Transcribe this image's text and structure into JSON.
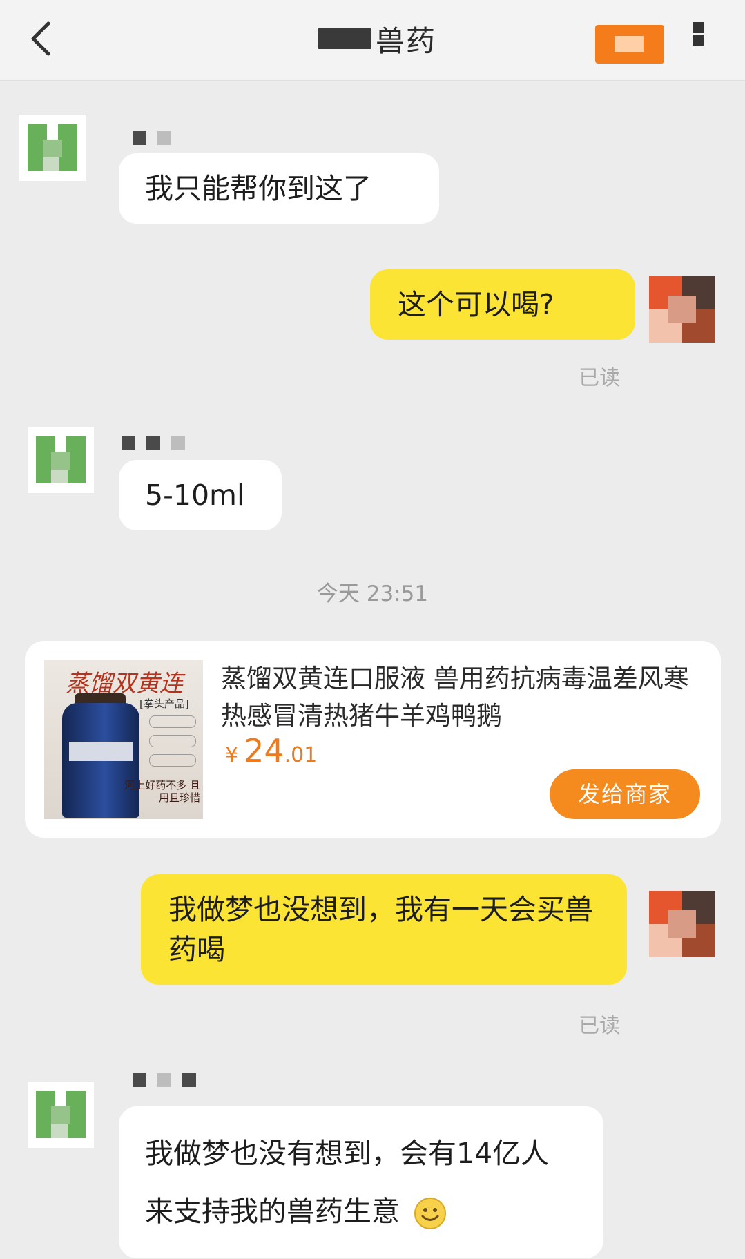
{
  "header": {
    "title": "兽药",
    "back_icon": "chevron-left-icon",
    "shop_icon": "store-icon",
    "more_icon": "more-icon"
  },
  "messages": [
    {
      "side": "left",
      "text": "我只能帮你到这了"
    },
    {
      "side": "right",
      "text": "这个可以喝?",
      "status": "已读"
    },
    {
      "side": "left",
      "text": "5-10ml"
    },
    {
      "side": "right",
      "text": "我做梦也没想到，我有一天会买兽药喝",
      "status": "已读"
    },
    {
      "side": "left",
      "text": "我做梦也没有想到，会有14亿人来支持我的兽药生意"
    }
  ],
  "timestamp": "今天 23:51",
  "product": {
    "title": "蒸馏双黄连口服液 兽用药抗病毒温差风寒热感冒清热猪牛羊鸡鸭鹅",
    "price_symbol": "¥",
    "price_integer": "24",
    "price_decimal": ".01",
    "send_button": "发给商家",
    "image": {
      "brand": "蒸馏双黄连",
      "tag": "[拳头产品]",
      "caption": "河上好药不多 且用且珍惜"
    }
  },
  "colors": {
    "accent": "#f58a1e",
    "self_bubble": "#fce435",
    "other_bubble": "#ffffff",
    "price": "#ee7a1c"
  }
}
